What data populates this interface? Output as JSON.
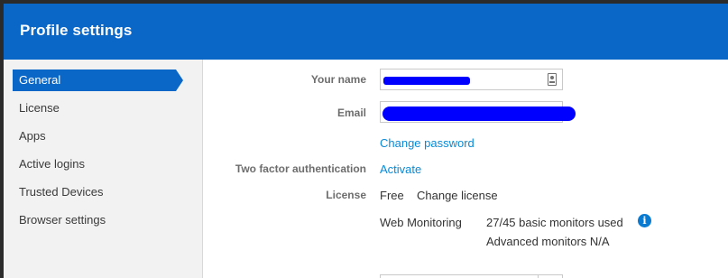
{
  "header": {
    "title": "Profile settings"
  },
  "sidebar": {
    "items": [
      {
        "label": "General",
        "active": true
      },
      {
        "label": "License",
        "active": false
      },
      {
        "label": "Apps",
        "active": false
      },
      {
        "label": "Active logins",
        "active": false
      },
      {
        "label": "Trusted Devices",
        "active": false
      },
      {
        "label": "Browser settings",
        "active": false
      }
    ]
  },
  "form": {
    "your_name_label": "Your name",
    "email_label": "Email",
    "change_password_link": "Change password",
    "two_factor_label": "Two factor authentication",
    "two_factor_action": "Activate",
    "license_label": "License",
    "license_value": "Free",
    "change_license_link": "Change license",
    "web_monitoring_label": "Web Monitoring",
    "basic_monitors_text": "27/45 basic monitors used",
    "advanced_monitors_text": "Advanced monitors N/A"
  },
  "colors": {
    "accent": "#0a67c8",
    "link": "#0a8ad6",
    "redaction": "#0000ff"
  },
  "icons": {
    "contact_card": "contact-card-icon",
    "info": "info-icon"
  }
}
